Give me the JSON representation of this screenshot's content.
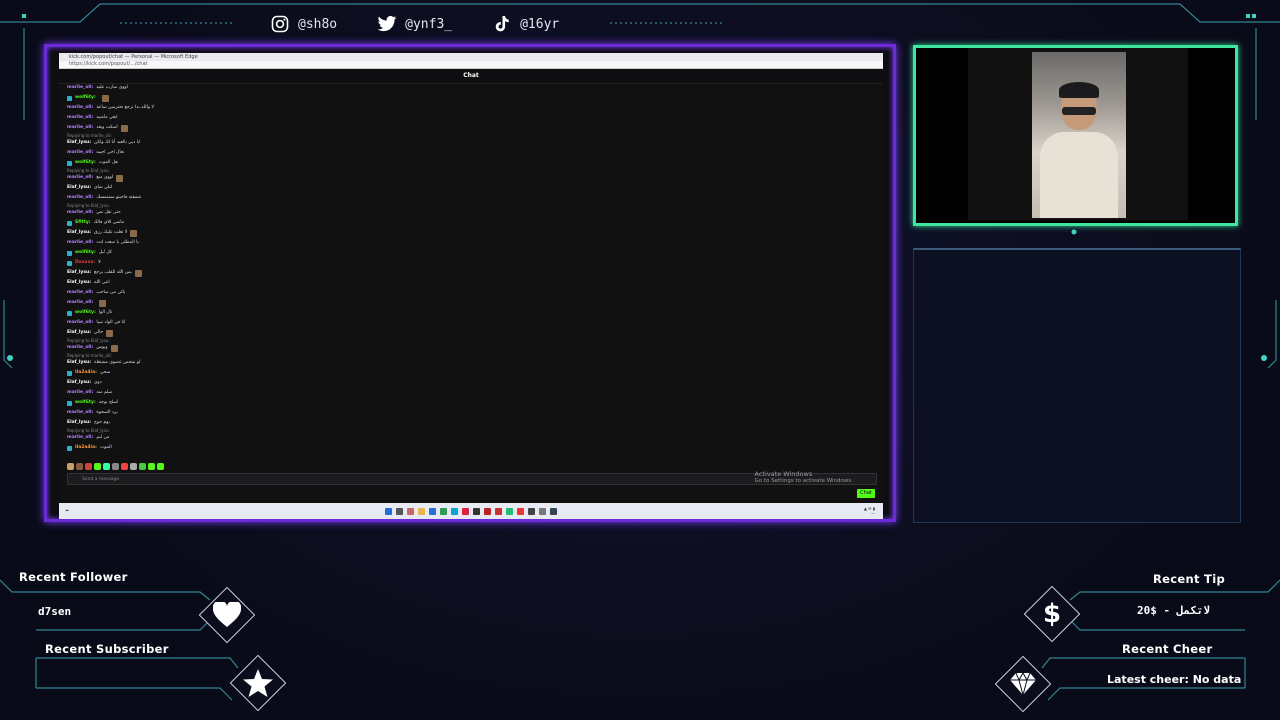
{
  "social": {
    "instagram": "@sh8o",
    "twitter": "@ynf3_",
    "tiktok": "@16yr"
  },
  "browser": {
    "tab_title": "kick.com/popout/chat — Personal — Microsoft Edge",
    "address": "https://kick.com/popout/.../chat",
    "chat_header": "Chat",
    "send_placeholder": "Send a message",
    "chat_button": "Chat",
    "activate_title": "Activate Windows",
    "activate_sub": "Go to Settings to activate Windows."
  },
  "chat_messages": [
    {
      "user": "marlie_o0:",
      "text": "اووي منارب عليه",
      "color": "#b980ff"
    },
    {
      "user": "wolf6ty:",
      "text": "",
      "color": "#53fc18",
      "badge": true,
      "emote": true
    },
    {
      "user": "marlie_o0:",
      "text": "لا والله بدا ترجع تحترمين ساعة",
      "color": "#b980ff"
    },
    {
      "user": "marlie_o0:",
      "text": "ابغي ماشيه",
      "color": "#b980ff"
    },
    {
      "user": "marlie_o0:",
      "text": "اسكت وبعد",
      "color": "#b980ff",
      "emote": true
    },
    {
      "user": "Elaf_lysu:",
      "text": "ابا دبي بالعيد أنا لك ولكن",
      "color": "#ffffff",
      "reply": "Replying to marlie_o0:"
    },
    {
      "user": "marlie_o0:",
      "text": "تعال اجي اجيبه",
      "color": "#b980ff"
    },
    {
      "user": "wolf6ty:",
      "text": "هل الموت",
      "color": "#53fc18",
      "badge": true
    },
    {
      "user": "marlie_o0:",
      "text": "اووي منغ",
      "color": "#b980ff",
      "reply": "Replying to Elaf_lysu:",
      "emote": true
    },
    {
      "user": "Elaf_lysu:",
      "text": "لتلي شاي",
      "color": "#ffffff"
    },
    {
      "user": "marlie_o0:",
      "text": "عشقته فاخيتو مشتمسك",
      "color": "#b980ff"
    },
    {
      "user": "marlie_o0:",
      "text": "حتى تقل نص",
      "color": "#b980ff",
      "reply": "Replying to Elaf_lysu:"
    },
    {
      "user": "Sfltty:",
      "text": "ماشي للاي فالك",
      "color": "#53fc18",
      "badge": true
    },
    {
      "user": "Elaf_lysu:",
      "text": "لا تعلت عليك رزق",
      "color": "#ffffff",
      "emote": true
    },
    {
      "user": "marlie_o0:",
      "text": "يا المطلي يا سعت انت",
      "color": "#b980ff"
    },
    {
      "user": "wolf6ty:",
      "text": "كل ليل",
      "color": "#53fc18",
      "badge": true
    },
    {
      "user": "Dxxxxx:",
      "text": "لا",
      "color": "#e04040",
      "badge": true
    },
    {
      "user": "Elaf_lysu:",
      "text": "بس الله للقلب يرجع",
      "color": "#ffffff",
      "emote": true
    },
    {
      "user": "Elaf_lysu:",
      "text": "انتي الله",
      "color": "#ffffff"
    },
    {
      "user": "marlie_o0:",
      "text": "يالي من صاحب",
      "color": "#b980ff"
    },
    {
      "user": "marlie_o0:",
      "text": "",
      "color": "#b980ff",
      "emote": true
    },
    {
      "user": "wolf6ty:",
      "text": "نال الوا",
      "color": "#53fc18",
      "badge": true
    },
    {
      "user": "marlie_o0:",
      "text": "انا في الواد تيبيا",
      "color": "#b980ff"
    },
    {
      "user": "Elaf_lysu:",
      "text": "حالي",
      "color": "#ffffff",
      "emote": true
    },
    {
      "user": "marlie_o0:",
      "text": "ويوس",
      "color": "#b980ff",
      "reply": "Replying to Elaf_lysu:",
      "emote": true
    },
    {
      "user": "Elaf_lysu:",
      "text": "لو شخص عضوي مشتغلة",
      "color": "#ffffff",
      "reply": "Replying to marlie_o0:"
    },
    {
      "user": "Ila2a4ia:",
      "text": "صحي",
      "color": "#ff9a3c",
      "badge": true
    },
    {
      "user": "Elaf_lysu:",
      "text": "دوي",
      "color": "#ffffff"
    },
    {
      "user": "marlie_o0:",
      "text": "صلم منه",
      "color": "#b980ff"
    },
    {
      "user": "wolf6ty:",
      "text": "اصلح بوجه",
      "color": "#53fc18",
      "badge": true
    },
    {
      "user": "marlie_o0:",
      "text": "يرد الصحوة",
      "color": "#b980ff"
    },
    {
      "user": "Elaf_lysu:",
      "text": "يوم حوج",
      "color": "#ffffff"
    },
    {
      "user": "marlie_o0:",
      "text": "من ليم",
      "color": "#b980ff",
      "reply": "Replying to Elaf_lysu:"
    },
    {
      "user": "Ila2a4ia:",
      "text": "الموت",
      "color": "#ff9a3c",
      "badge": true
    }
  ],
  "widgets": {
    "recent_follower": {
      "title": "Recent Follower",
      "value": "d7sen"
    },
    "recent_subscriber": {
      "title": "Recent Subscriber",
      "value": ""
    },
    "recent_tip": {
      "title": "Recent Tip",
      "value": "لاتكمل - $20"
    },
    "recent_cheer": {
      "title": "Recent Cheer",
      "value": "Latest cheer: No data"
    }
  },
  "colors": {
    "screen_border": "#6b2bd6",
    "cam_border": "#3ee6a0",
    "accent_cyan": "#3fd4c8",
    "kick_green": "#53fc18"
  }
}
